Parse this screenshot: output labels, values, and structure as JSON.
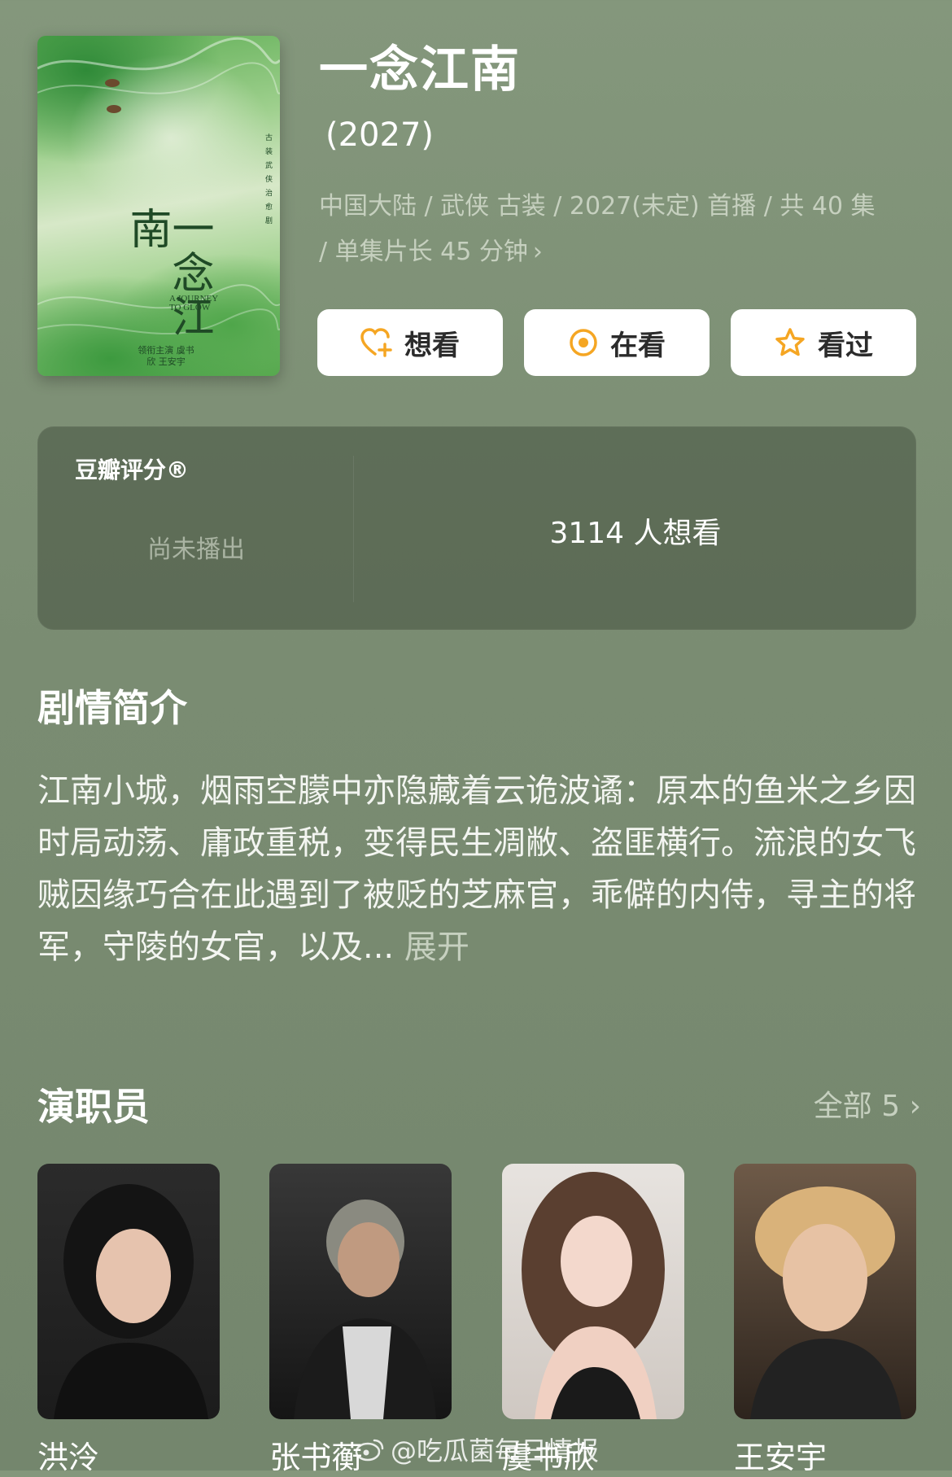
{
  "show": {
    "poster": {
      "title": "一念江南",
      "subtitle": "A JOURNEY TO GLOW",
      "tagline": "古装武侠治愈剧",
      "credits": "领衔主演 虞书欣 王安宇"
    },
    "title": "一念江南",
    "year": "(2027)",
    "meta": "中国大陆 / 武侠 古装 / 2027(未定) 首播 / 共 40 集 / 单集片长 45 分钟",
    "meta_chevron": "›"
  },
  "actions": [
    {
      "label": "想看",
      "icon": "heart-plus-icon"
    },
    {
      "label": "在看",
      "icon": "target-icon"
    },
    {
      "label": "看过",
      "icon": "star-icon"
    }
  ],
  "rating": {
    "label": "豆瓣评分®",
    "status": "尚未播出",
    "wish_count": "3114 人想看"
  },
  "synopsis": {
    "title": "剧情简介",
    "text": "江南小城，烟雨空朦中亦隐藏着云诡波谲：原本的鱼米之乡因时局动荡、庸政重税，变得民生凋敝、盗匪横行。流浪的女飞贼因缘巧合在此遇到了被贬的芝麻官，乖僻的内侍，寻主的将军，守陵的女官，以及...",
    "expand": "展开"
  },
  "cast": {
    "title": "演职员",
    "all_label": "全部 5",
    "all_chevron": "›",
    "members": [
      {
        "name": "洪泠"
      },
      {
        "name": "张书蘅"
      },
      {
        "name": "虞书欣"
      },
      {
        "name": "王安宇"
      }
    ]
  },
  "watermark": "@吃瓜菌每日情报",
  "colors": {
    "background": "#7f9178",
    "accent": "#f5a623",
    "card": "#556049"
  }
}
